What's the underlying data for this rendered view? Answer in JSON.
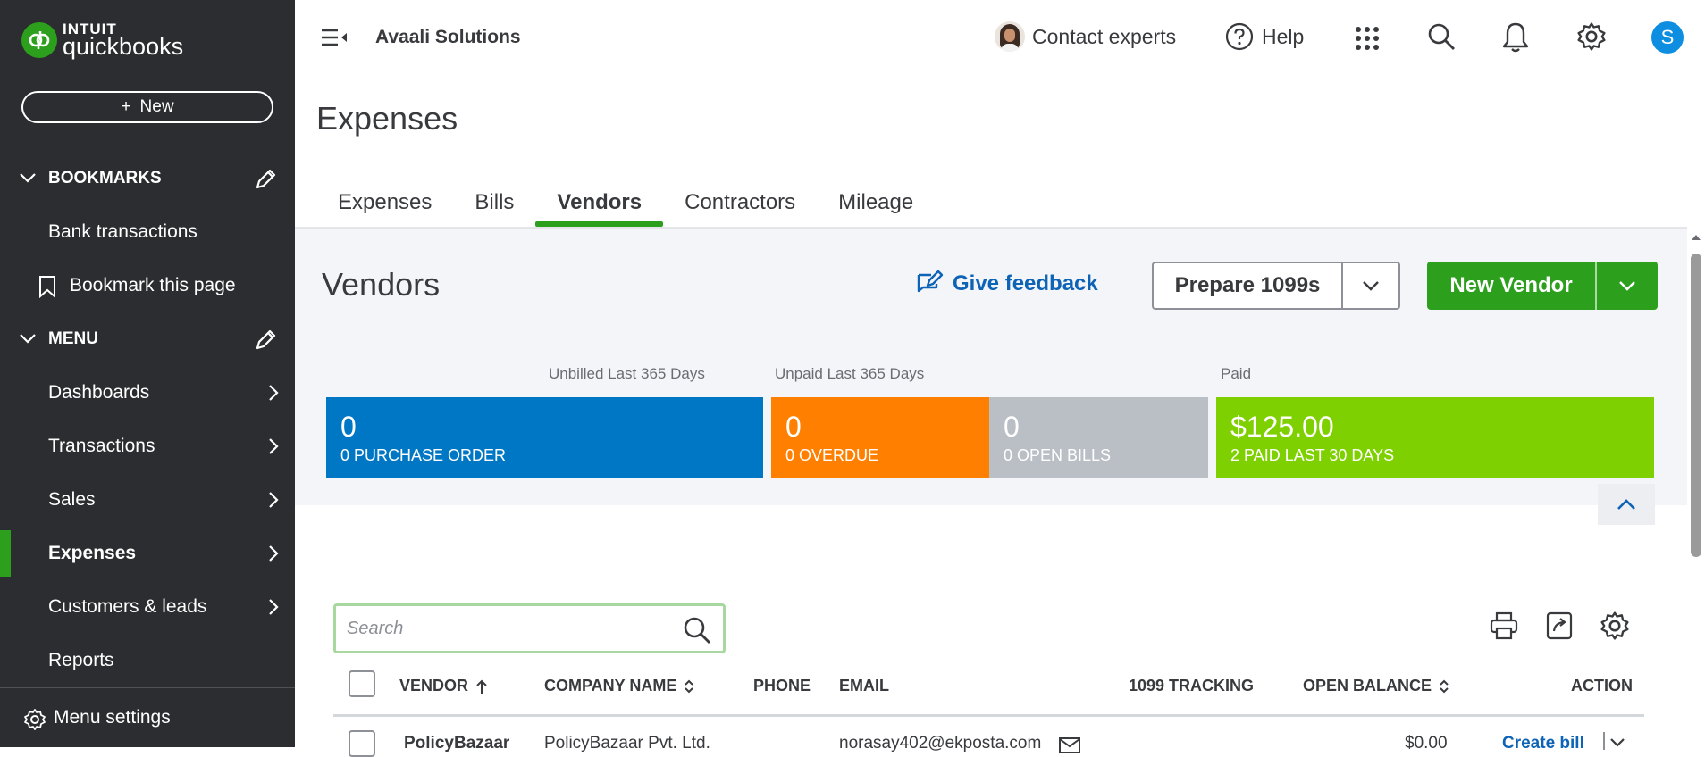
{
  "sidebar": {
    "logo_brand": "INTUIT",
    "logo_product": "quickbooks",
    "new_label": "New",
    "bookmarks_label": "BOOKMARKS",
    "bookmark_items": [
      "Bank transactions",
      "Bookmark this page"
    ],
    "menu_label": "MENU",
    "menu_items": [
      "Dashboards",
      "Transactions",
      "Sales",
      "Expenses",
      "Customers & leads",
      "Reports"
    ],
    "active_item": "Expenses",
    "menu_settings_label": "Menu settings"
  },
  "topbar": {
    "company_name": "Avaali Solutions",
    "contact_experts": "Contact experts",
    "help": "Help",
    "avatar_initial": "S"
  },
  "page": {
    "title": "Expenses",
    "tabs": [
      "Expenses",
      "Bills",
      "Vendors",
      "Contractors",
      "Mileage"
    ],
    "active_tab": "Vendors"
  },
  "vendors_panel": {
    "title": "Vendors",
    "give_feedback": "Give feedback",
    "prepare_1099s": "Prepare 1099s",
    "new_vendor": "New Vendor",
    "label_unbilled": "Unbilled Last 365 Days",
    "label_unpaid": "Unpaid Last 365 Days",
    "label_paid": "Paid",
    "blocks": [
      {
        "big": "0",
        "small": "0  PURCHASE ORDER",
        "color": "#0077c5"
      },
      {
        "big": "0",
        "small": "0  OVERDUE",
        "color": "#ff8000"
      },
      {
        "big": "0",
        "small": "0  OPEN BILLS",
        "color": "#babec5"
      },
      {
        "big": "$125.00",
        "small": "2  PAID LAST 30 DAYS",
        "color": "#7fd000"
      }
    ]
  },
  "table": {
    "search_placeholder": "Search",
    "columns": {
      "vendor": "VENDOR",
      "company": "COMPANY NAME",
      "phone": "PHONE",
      "email": "EMAIL",
      "tracking": "1099 TRACKING",
      "balance": "OPEN BALANCE",
      "action": "ACTION"
    },
    "rows": [
      {
        "vendor": "PolicyBazaar",
        "company": "PolicyBazaar Pvt. Ltd.",
        "phone": "",
        "email": "norasay402@ekposta.com",
        "tracking": "",
        "balance": "$0.00",
        "action": "Create bill"
      }
    ]
  }
}
